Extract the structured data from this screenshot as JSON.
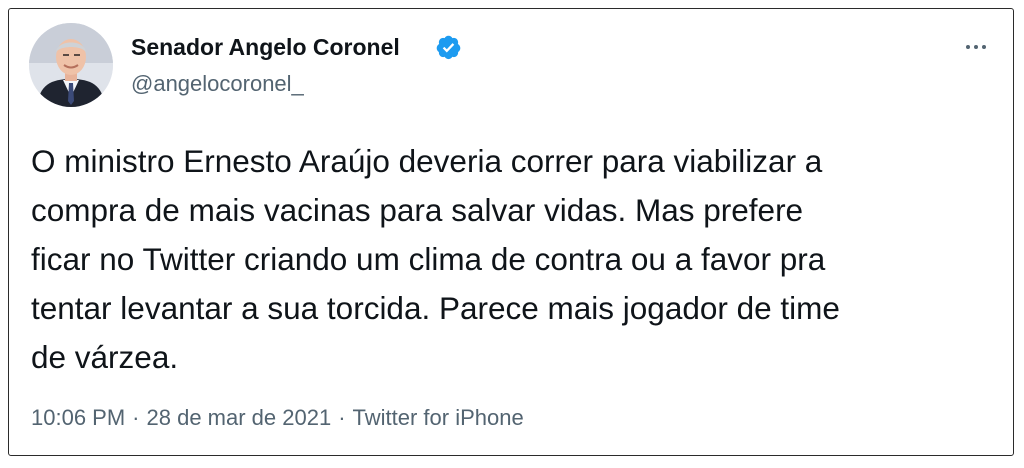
{
  "tweet": {
    "author": {
      "name": "Senador Angelo Coronel",
      "handle": "@angelocoronel_",
      "verified": true,
      "verified_icon": "verified-badge-icon",
      "avatar_icon": "profile-photo"
    },
    "more_icon": "more-options-icon",
    "text_lines": [
      "O ministro Ernesto Araújo deveria correr para viabilizar a",
      "compra de mais vacinas para salvar vidas. Mas prefere",
      "ficar no Twitter criando um clima de contra ou a favor pra",
      "tentar levantar a sua torcida. Parece mais jogador de time",
      "de várzea."
    ],
    "time": "10:06 PM",
    "separator": "·",
    "date": "28 de mar de 2021",
    "source": "Twitter for iPhone"
  },
  "colors": {
    "text": "#0f1419",
    "secondary": "#536471",
    "verified": "#1d9bf0",
    "border": "#2b2b2b"
  }
}
